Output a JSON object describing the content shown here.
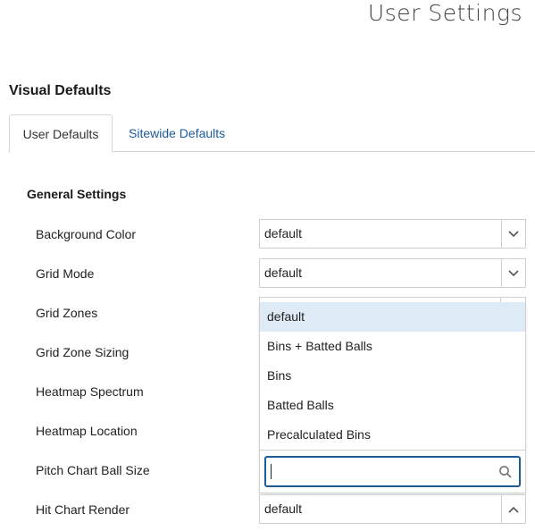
{
  "page": {
    "title": "User Settings"
  },
  "section": {
    "title": "Visual Defaults"
  },
  "tabs": [
    {
      "label": "User Defaults",
      "active": true
    },
    {
      "label": "Sitewide Defaults",
      "active": false
    }
  ],
  "general": {
    "title": "General Settings",
    "rows": [
      {
        "label": "Background Color",
        "value": "default"
      },
      {
        "label": "Grid Mode",
        "value": "default"
      },
      {
        "label": "Grid Zones"
      },
      {
        "label": "Grid Zone Sizing"
      },
      {
        "label": "Heatmap Spectrum"
      },
      {
        "label": "Heatmap Location"
      },
      {
        "label": "Pitch Chart Ball Size"
      },
      {
        "label": "Hit Chart Render",
        "value": "default"
      }
    ]
  },
  "dropdown": {
    "options": [
      "default",
      "Bins + Batted Balls",
      "Bins",
      "Batted Balls",
      "Precalculated Bins"
    ],
    "highlighted_index": 0,
    "search_value": ""
  },
  "icons": {
    "select_arrow": "chevron-down-icon",
    "open_arrow": "chevron-up-icon",
    "search": "search-icon"
  },
  "colors": {
    "link": "#1d5a9a",
    "highlight": "#deebf6",
    "focus_border": "#1f5b97"
  }
}
